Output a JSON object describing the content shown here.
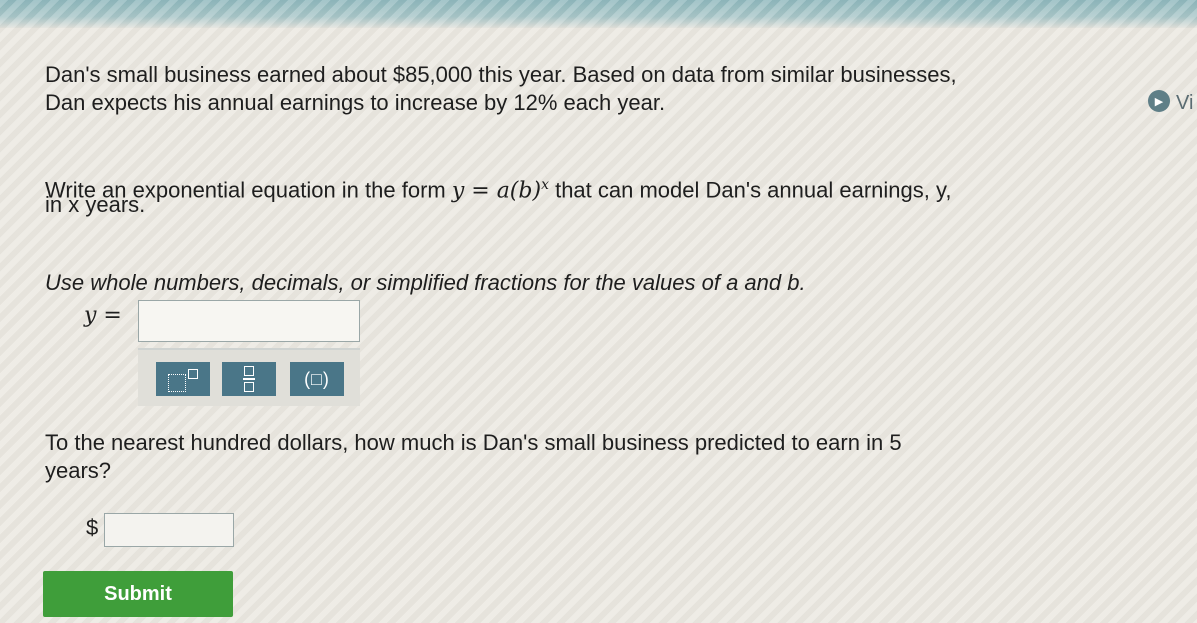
{
  "problem": {
    "line1": "Dan's small business earned about $85,000 this year. Based on data from similar businesses,",
    "line2": "Dan expects his annual earnings to increase by 12% each year.",
    "line3_a": "Write an exponential equation in the form ",
    "line3_eq": "y = a(b)",
    "line3_sup": "x",
    "line3_b": " that can model Dan's annual earnings, y,",
    "line4": "in x years.",
    "line5": "Use whole numbers, decimals, or simplified fractions for the values of a and b.",
    "question2_line1": "To the nearest hundred dollars, how much is Dan's small business predicted to earn in 5",
    "question2_line2": "years?"
  },
  "answer1": {
    "label": "y =",
    "value": ""
  },
  "answer2": {
    "currency": "$",
    "value": ""
  },
  "toolbar": {
    "paren_label": "(□)"
  },
  "submit_label": "Submit",
  "video": {
    "label": "Vi"
  }
}
